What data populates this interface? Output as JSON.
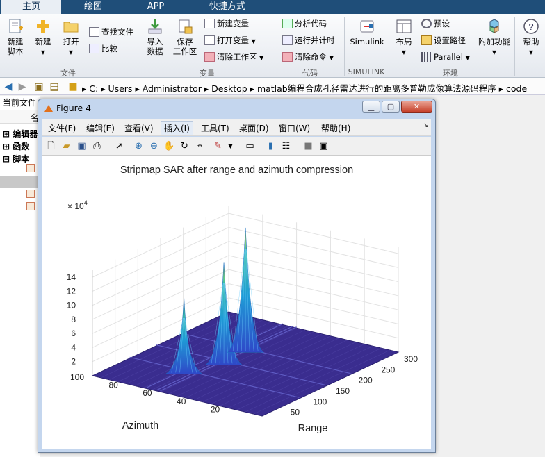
{
  "tabs": [
    "主页",
    "绘图",
    "APP",
    "快捷方式"
  ],
  "ribbon": {
    "new_script": "新建\n脚本",
    "new": "新建",
    "open": "打开",
    "find_files": "查找文件",
    "compare": "比较",
    "import_data": "导入\n数据",
    "save_workspace": "保存\n工作区",
    "new_variable": "新建变量",
    "open_variable": "打开变量",
    "clear_workspace": "清除工作区",
    "analyze_code": "分析代码",
    "run_and_time": "运行并计时",
    "clear_commands": "清除命令",
    "simulink": "Simulink",
    "layout": "布局",
    "preferences": "预设",
    "set_path": "设置路径",
    "parallel": "Parallel",
    "addons": "附加功能",
    "help": "帮助",
    "groups": [
      "文件",
      "变量",
      "代码",
      "SIMULINK",
      "环境"
    ]
  },
  "address": {
    "crumbs": [
      "C:",
      "Users",
      "Administrator",
      "Desktop",
      "matlab编程合成孔径雷达进行的距离多普勒成像算法源码程序",
      "code"
    ]
  },
  "left_panel": {
    "header": "当前文件",
    "col": "名",
    "tree": [
      "编辑器",
      "函数",
      "脚本"
    ]
  },
  "figure": {
    "window_title": "Figure 4",
    "menus": [
      "文件(F)",
      "编辑(E)",
      "查看(V)",
      "插入(I)",
      "工具(T)",
      "桌面(D)",
      "窗口(W)",
      "帮助(H)"
    ],
    "plot_title": "Stripmap SAR after range and azimuth compression",
    "xlabel": "Range",
    "ylabel": "Azimuth",
    "z_exponent_base": "× 10",
    "z_exponent": "4"
  },
  "chart_data": {
    "type": "surface",
    "title": "Stripmap SAR after range and azimuth compression",
    "xlabel": "Range",
    "ylabel": "Azimuth",
    "zlabel": "",
    "x_ticks": [
      50,
      100,
      150,
      200,
      250,
      300
    ],
    "y_ticks": [
      20,
      40,
      60,
      80,
      100
    ],
    "z_ticks": [
      2,
      4,
      6,
      8,
      10,
      12,
      14
    ],
    "z_scale_exponent": 4,
    "xlim": [
      0,
      300
    ],
    "ylim": [
      0,
      100
    ],
    "zlim": [
      0,
      15
    ],
    "grid": true,
    "colormap": "parula",
    "surface_color": "#3a2d8f",
    "peaks": [
      {
        "x": 82,
        "y": 68,
        "z": 10.5
      },
      {
        "x": 140,
        "y": 60,
        "z": 14.2
      },
      {
        "x": 195,
        "y": 62,
        "z": 17.3
      }
    ]
  },
  "colors": {
    "title_bar": "#1f4e79",
    "surface": "#3a2d8f"
  }
}
